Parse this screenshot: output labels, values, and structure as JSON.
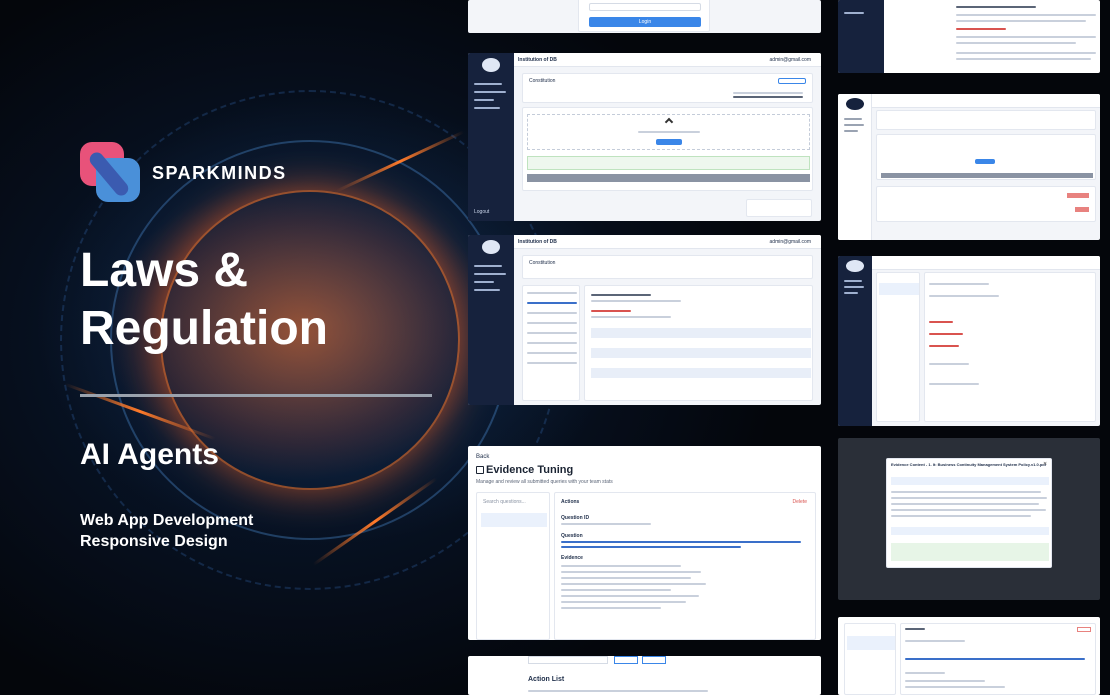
{
  "brand": {
    "name": "SPARKMINDS"
  },
  "hero": {
    "title_line1": "Laws &",
    "title_line2": "Regulation",
    "subtitle": "AI Agents",
    "service1": "Web App Development",
    "service2": "Responsive Design"
  },
  "screens": {
    "login_button": "Login",
    "app_title": "Institution of DB",
    "user_email": "admin@gmail.com",
    "constitution": "Constitution",
    "upload_btn": "Upload Doc",
    "logout": "Logout",
    "evidence": {
      "back": "Back",
      "title": "Evidence Tuning",
      "subtitle": "Manage and review all submitted queries with your team stats",
      "search_placeholder": "Search questions...",
      "actions": "Actions",
      "delete": "Delete",
      "question_id": "Question ID",
      "question": "Question",
      "evidence_label": "Evidence"
    },
    "action_list": "Action List",
    "evidence_modal_title": "Evidence Content - 1. It: Business Continuity Management System Policy.v1.0.pdf"
  },
  "colors": {
    "accent": "#3a86e8",
    "sidebar": "#16223d",
    "glow": "#ff7a2a"
  }
}
